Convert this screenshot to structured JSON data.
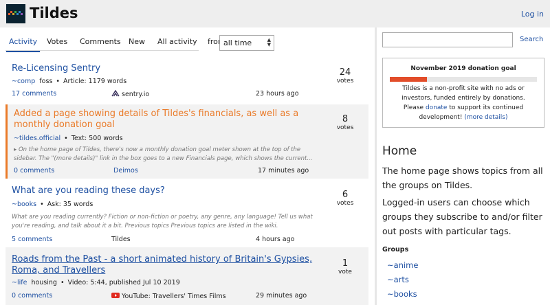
{
  "header": {
    "site_title": "Tildes",
    "login_label": "Log in",
    "logo_icon": "tildes-logo-icon"
  },
  "listing": {
    "tabs": [
      {
        "label": "Activity",
        "active": true
      },
      {
        "label": "Votes",
        "active": false
      },
      {
        "label": "Comments",
        "active": false
      },
      {
        "label": "New",
        "active": false
      },
      {
        "label": "All activity",
        "active": false
      }
    ],
    "from_label": "from",
    "period_value": "all time"
  },
  "topics": [
    {
      "title": "Re-Licensing Sentry",
      "group": "~comp",
      "tags": "foss",
      "type_info": "Article: 1179 words",
      "excerpt": "",
      "comments": "17 comments",
      "source": "sentry.io",
      "time": "23 hours ago",
      "votes": "24",
      "votes_label": "votes"
    },
    {
      "title": "Added a page showing details of Tildes's financials, as well as a monthly donation goal",
      "group": "~tildes.official",
      "tags": "",
      "type_info": "Text: 500 words",
      "excerpt": "On the home page of Tildes, there's now a monthly donation goal meter shown at the top of the sidebar. The \"(more details)\" link in the box goes to a new Financials page, which shows the current...",
      "comments": "0 comments",
      "source": "Deimos",
      "time": "17 minutes ago",
      "votes": "8",
      "votes_label": "votes"
    },
    {
      "title": "What are you reading these days?",
      "group": "~books",
      "tags": "",
      "type_info": "Ask: 35 words",
      "excerpt": "What are you reading currently? Fiction or non-fiction or poetry, any genre, any language! Tell us what you're reading, and talk about it a bit. Previous topics Previous topics are listed in the wiki.",
      "comments": "5 comments",
      "source": "Tildes",
      "time": "4 hours ago",
      "votes": "6",
      "votes_label": "votes"
    },
    {
      "title": "Roads from the Past - a short animated history of Britain's Gypsies, Roma, and Travellers",
      "group": "~life",
      "tags": "housing",
      "type_info": "Video: 5:44, published Jul 10 2019",
      "excerpt": "",
      "comments": "0 comments",
      "source": "YouTube: Travellers' Times Films",
      "time": "29 minutes ago",
      "votes": "1",
      "votes_label": "vote"
    }
  ],
  "sidebar": {
    "search_label": "Search",
    "donation": {
      "title": "November 2019 donation goal",
      "progress_percent": 25,
      "text1": "Tildes is a non-profit site with no ads or investors, funded entirely by donations.",
      "please": "Please",
      "donate_link": "donate",
      "text2": "to support its continued development!",
      "more_details": "(more details)"
    },
    "home_title": "Home",
    "home_desc": "The home page shows topics from all the groups on Tildes.",
    "home_desc2": "Logged-in users can choose which groups they subscribe to and/or filter out posts with particular tags.",
    "groups_heading": "Groups",
    "groups": [
      "~anime",
      "~arts",
      "~books"
    ]
  },
  "colors": {
    "link": "#1e50a2",
    "accent": "#ea7a28",
    "progress": "#e24d2a"
  }
}
